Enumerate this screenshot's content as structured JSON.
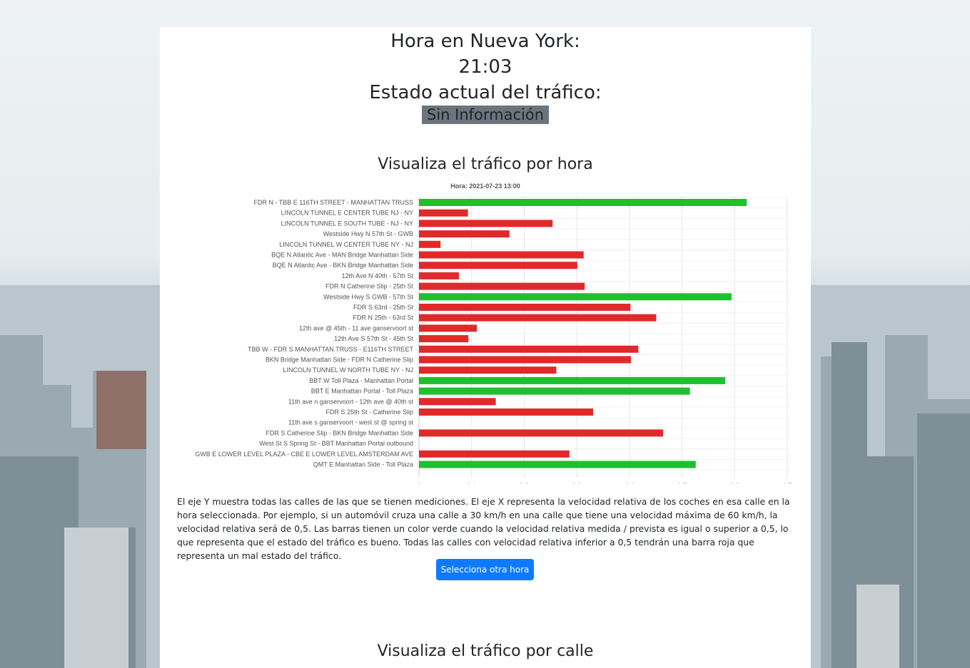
{
  "header": {
    "time_label": "Hora en Nueva York:",
    "time_value": "21:03",
    "status_label": "Estado actual del tráfico:",
    "status_badge": "Sin Información"
  },
  "hour_section": {
    "title": "Visualiza el tráfico por hora",
    "description": "El eje Y muestra todas las calles de las que se tienen mediciones. El eje X representa la velocidad relativa de los coches en esa calle en la hora seleccionada. Por ejemplo, si un automóvil cruza una calle a 30 km/h en una calle que tiene una velocidad máxima de 60 km/h, la velocidad relativa será de 0,5. Las barras tienen un color verde cuando la velocidad relativa medida / prevista es igual o superior a 0,5, lo que representa que el estado del tráfico es bueno. Todas las calles con velocidad relativa inferior a 0,5 tendrán una barra roja que representa un mal estado del tráfico.",
    "button_label": "Selecciona otra hora"
  },
  "street_section": {
    "title": "Visualiza el tráfico por calle"
  },
  "colors": {
    "good": "#1fbf2f",
    "bad": "#e02a2a",
    "badge_bg": "#6c757d",
    "button": "#0d7bff"
  },
  "chart_data": {
    "type": "bar",
    "orientation": "horizontal",
    "title": "Hora:  2021-07-23 13:00",
    "xlim": [
      0,
      0.7
    ],
    "x_ticks": [
      "0",
      "0,1",
      "0,2",
      "0,3",
      "0,4",
      "0,5",
      "0,6",
      "0,7"
    ],
    "grid": true,
    "threshold": 0.5,
    "categories": [
      "FDR N - TBB E 116TH STREET - MANHATTAN TRUSS",
      "LINCOLN TUNNEL E CENTER TUBE NJ - NY",
      "LINCOLN TUNNEL E SOUTH TUBE - NJ - NY",
      "Westside Hwy N 57th St - GWB",
      "LINCOLN TUNNEL W CENTER TUBE NY - NJ",
      "BQE N Atlantic Ave - MAN Bridge Manhattan Side",
      "BQE N Atlantic Ave - BKN Bridge Manhattan Side",
      "12th Ave N 40th - 57th St",
      "FDR N Catherine Slip - 25th St",
      "Westside Hwy S GWB - 57th St",
      "FDR S 63rd - 25th St",
      "FDR N 25th - 63rd St",
      "12th ave @ 45th - 11 ave ganservoort st",
      "12th Ave S 57th St - 45th St",
      "TBB W - FDR S MANHATTAN TRUSS - E116TH STREET",
      "BKN Bridge Manhattan Side - FDR N Catherine Slip",
      "LINCOLN TUNNEL W NORTH TUBE NY - NJ",
      "BBT W Toll Plaza - Manhattan Portal",
      "BBT E Manhattan Portal - Toll Plaza",
      "11th ave n ganservoort - 12th ave @ 40th st",
      "FDR S 25th St - Catherine Slip",
      "11th ave s ganservoort - west st @ spring st",
      "FDR S Catherine Slip - BKN Bridge Manhattan Side",
      "West St S Spring St - BBT Manhattan Portal outbound",
      "GWB E LOWER LEVEL PLAZA - CBE E LOWER LEVEL AMSTERDAM AVE",
      "QMT E Manhattan Side - Toll Plaza"
    ],
    "values": [
      0.623,
      0.093,
      0.254,
      0.172,
      0.041,
      0.313,
      0.301,
      0.076,
      0.315,
      0.594,
      0.402,
      0.451,
      0.11,
      0.094,
      0.417,
      0.403,
      0.261,
      0.582,
      0.515,
      0.146,
      0.331,
      0,
      0.464,
      0,
      0.286,
      0.526
    ]
  }
}
